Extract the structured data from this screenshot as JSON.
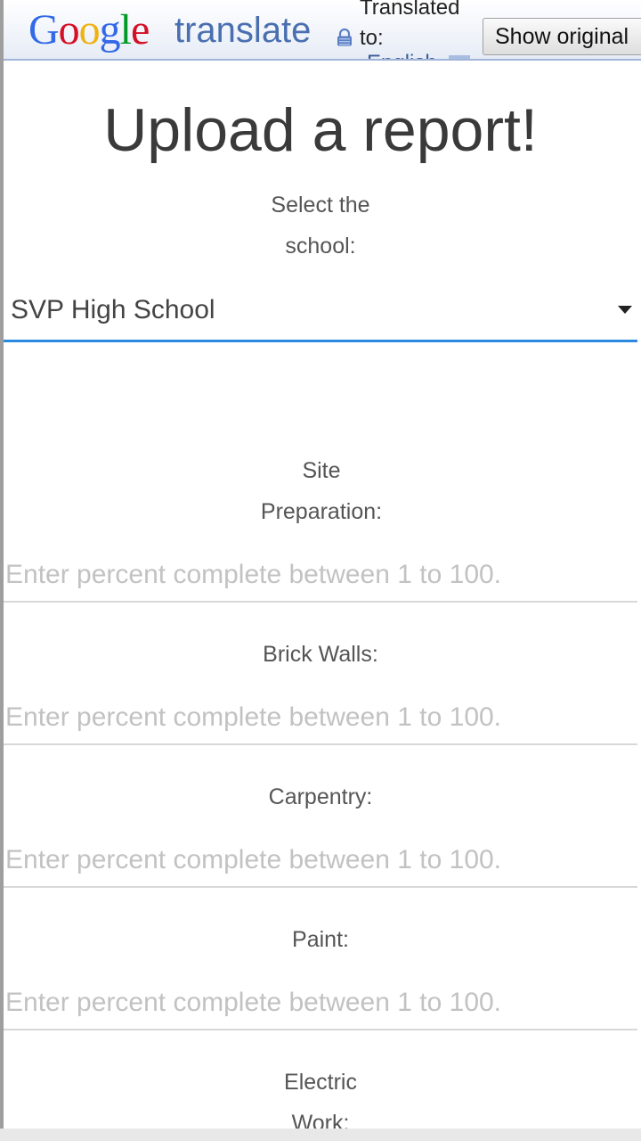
{
  "translate_bar": {
    "logo_letters": [
      "G",
      "o",
      "o",
      "g",
      "l",
      "e"
    ],
    "logo_word": "translate",
    "translated_label": "Translated",
    "to_label": "to:",
    "language": "English",
    "show_original_label": "Show original"
  },
  "form": {
    "title": "Upload a report!",
    "school_label_line1": "Select the",
    "school_label_line2": "school:",
    "school_selected": "SVP High School",
    "fields": [
      {
        "label_line1": "Site",
        "label_line2": "Preparation:",
        "placeholder": "Enter percent complete between 1 to 100."
      },
      {
        "label_line1": "Brick Walls:",
        "placeholder": "Enter percent complete between 1 to 100."
      },
      {
        "label_line1": "Carpentry:",
        "placeholder": "Enter percent complete between 1 to 100."
      },
      {
        "label_line1": "Paint:",
        "placeholder": "Enter percent complete between 1 to 100."
      },
      {
        "label_line1": "Electric",
        "label_line2": "Work:"
      }
    ]
  },
  "colors": {
    "accent_underline": "#2b8ae0",
    "title_text": "#3a3a3a",
    "placeholder_text": "#c2c2c2"
  }
}
